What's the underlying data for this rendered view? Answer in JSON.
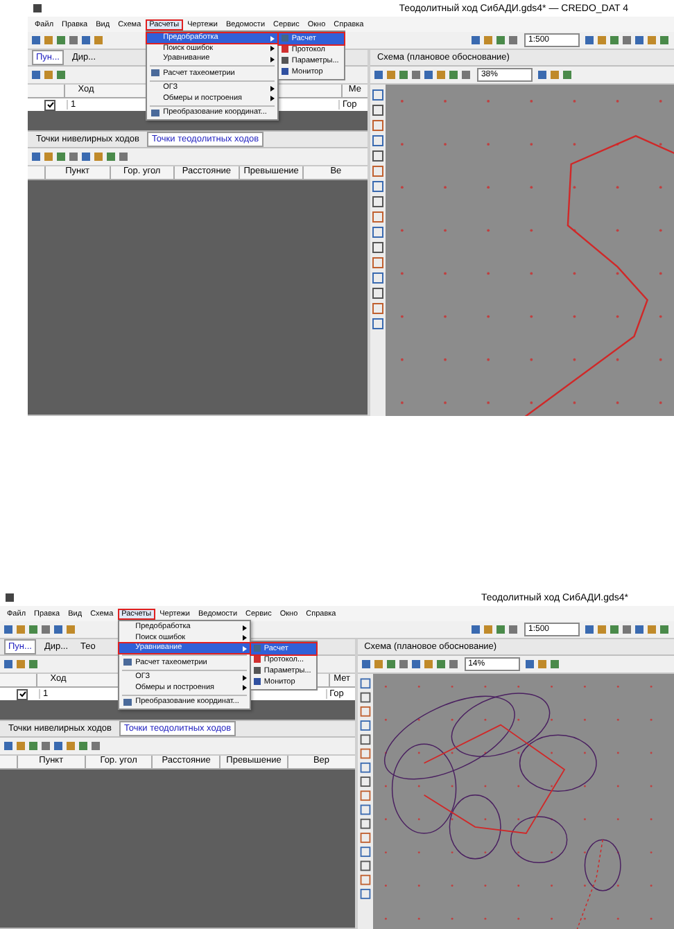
{
  "shots": [
    {
      "title": "Теодолитный ход СибАДИ.gds4* — CREDO_DAT 4",
      "menu": [
        {
          "label": "Файл",
          "selected": false
        },
        {
          "label": "Правка",
          "selected": false
        },
        {
          "label": "Вид",
          "selected": false
        },
        {
          "label": "Схема",
          "selected": false
        },
        {
          "label": "Расчеты",
          "selected": true
        },
        {
          "label": "Чертежи",
          "selected": false
        },
        {
          "label": "Ведомости",
          "selected": false
        },
        {
          "label": "Сервис",
          "selected": false
        },
        {
          "label": "Окно",
          "selected": false
        },
        {
          "label": "Справка",
          "selected": false
        }
      ],
      "dropdown": [
        {
          "kind": "item",
          "label": "Предобработка",
          "selected": true
        },
        {
          "kind": "item",
          "label": "Поиск ошибок",
          "selected": false
        },
        {
          "kind": "item",
          "label": "Уравнивание",
          "selected": false
        },
        {
          "kind": "separator"
        },
        {
          "kind": "tool",
          "label": "Расчет тахеометрии",
          "selected": false
        },
        {
          "kind": "separator"
        },
        {
          "kind": "item",
          "label": "ОГЗ",
          "selected": false
        },
        {
          "kind": "item",
          "label": "Обмеры и построения",
          "selected": false
        },
        {
          "kind": "separator"
        },
        {
          "kind": "tool",
          "label": "Преобразование координат...",
          "selected": false
        }
      ],
      "submenu": [
        {
          "label": "Расчет",
          "selected": true
        },
        {
          "label": "Протокол",
          "selected": false
        },
        {
          "label": "Параметры...",
          "selected": false
        },
        {
          "label": "Монитор",
          "selected": false
        }
      ],
      "scale": "1:500",
      "top_pane": {
        "tabs": [
          {
            "label": "Пун...",
            "selected": true
          },
          {
            "label": "Дир...",
            "selected": false
          }
        ],
        "columns": [
          "Ход",
          "Ме"
        ],
        "row": {
          "checked": true,
          "cells": [
            "1",
            "Гор"
          ]
        }
      },
      "bottom_pane": {
        "tabs": [
          {
            "label": "Точки нивелирных ходов",
            "selected": false
          },
          {
            "label": "Точки теодолитных ходов",
            "selected": true
          }
        ],
        "columns": [
          "Пункт",
          "Гор. угол",
          "Расстояние",
          "Превышение",
          "Ве"
        ]
      },
      "scheme": {
        "title": "Схема (плановое обоснование)",
        "zoom": "38%"
      },
      "canvas": {
        "kind": "traverse"
      }
    },
    {
      "title": "Теодолитный ход СибАДИ.gds4*",
      "menu": [
        {
          "label": "Файл",
          "selected": false
        },
        {
          "label": "Правка",
          "selected": false
        },
        {
          "label": "Вид",
          "selected": false
        },
        {
          "label": "Схема",
          "selected": false
        },
        {
          "label": "Расчеты",
          "selected": true
        },
        {
          "label": "Чертежи",
          "selected": false
        },
        {
          "label": "Ведомости",
          "selected": false
        },
        {
          "label": "Сервис",
          "selected": false
        },
        {
          "label": "Окно",
          "selected": false
        },
        {
          "label": "Справка",
          "selected": false
        }
      ],
      "dropdown": [
        {
          "kind": "item",
          "label": "Предобработка",
          "selected": false
        },
        {
          "kind": "item",
          "label": "Поиск ошибок",
          "selected": false
        },
        {
          "kind": "item",
          "label": "Уравнивание",
          "selected": true
        },
        {
          "kind": "separator"
        },
        {
          "kind": "tool",
          "label": "Расчет тахеометрии",
          "selected": false
        },
        {
          "kind": "separator"
        },
        {
          "kind": "item",
          "label": "ОГЗ",
          "selected": false
        },
        {
          "kind": "item",
          "label": "Обмеры и построения",
          "selected": false
        },
        {
          "kind": "separator"
        },
        {
          "kind": "tool",
          "label": "Преобразование координат...",
          "selected": false
        }
      ],
      "submenu": [
        {
          "label": "Расчет",
          "selected": true
        },
        {
          "label": "Протокол...",
          "selected": false
        },
        {
          "label": "Параметры...",
          "selected": false
        },
        {
          "label": "Монитор",
          "selected": false
        }
      ],
      "scale": "1:500",
      "top_pane": {
        "tabs": [
          {
            "label": "Пун...",
            "selected": true
          },
          {
            "label": "Дир...",
            "selected": false
          },
          {
            "label": "Тео",
            "selected": false
          }
        ],
        "columns": [
          "Ход",
          "Мет"
        ],
        "row": {
          "checked": true,
          "cells": [
            "1",
            "Гор"
          ]
        }
      },
      "bottom_pane": {
        "tabs": [
          {
            "label": "Точки нивелирных ходов",
            "selected": false
          },
          {
            "label": "Точки теодолитных ходов",
            "selected": true
          }
        ],
        "columns": [
          "Пункт",
          "Гор. угол",
          "Расстояние",
          "Превышение",
          "Вер"
        ]
      },
      "scheme": {
        "title": "Схема (плановое обоснование)",
        "zoom": "14%"
      },
      "canvas": {
        "kind": "ellipses"
      }
    }
  ]
}
